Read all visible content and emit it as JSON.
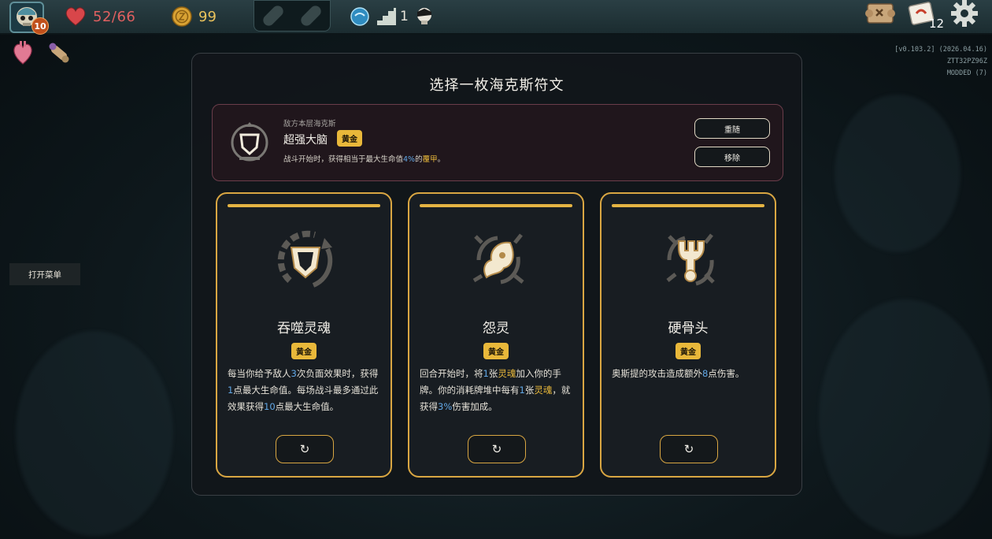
{
  "topbar": {
    "level": "10",
    "hp": "52/66",
    "gold": "99",
    "floor": "1",
    "deck_count": "12"
  },
  "icons": {
    "character": "skull-helmet-icon",
    "hp": "heart-icon",
    "gold": "coin-icon",
    "floor": "stairs-icon",
    "map": "map-scroll-icon",
    "deck": "card-deck-icon",
    "settings": "gear-icon",
    "reroll": "refresh-icon"
  },
  "version": {
    "line1": "[v0.103.2] (2026.04.16)",
    "line2": "ZTT32PZ96Z",
    "line3": "MODDED (7)"
  },
  "menu": {
    "open_label": "打开菜单"
  },
  "panel": {
    "title": "选择一枚海克斯符文",
    "enemy": {
      "subtitle": "敌方本层海克斯",
      "name": "超强大脑",
      "tier": "黄金",
      "desc_pre": "战斗开始时，获得相当于最大生命值",
      "desc_pct": "4%",
      "desc_mid": "的",
      "desc_kw": "覆甲",
      "desc_end": "。",
      "reroll_label": "重随",
      "remove_label": "移除"
    },
    "cards": [
      {
        "name": "吞噬灵魂",
        "tier": "黄金",
        "d1": "每当你给予敌人",
        "n1": "3",
        "d2": "次负面效果时，获得",
        "n2": "1",
        "d3": "点最大生命值。每场战斗最多通过此效果获得",
        "n3": "10",
        "d4": "点最大生命值。"
      },
      {
        "name": "怨灵",
        "tier": "黄金",
        "d1": "回合开始时，将",
        "n1": "1",
        "d2": "张",
        "k1": "灵魂",
        "d3": "加入你的手牌。你的消耗牌堆中每有",
        "n2": "1",
        "d4": "张",
        "k2": "灵魂",
        "d5": "，就获得",
        "n3": "3%",
        "d6": "伤害加成。"
      },
      {
        "name": "硬骨头",
        "tier": "黄金",
        "d1": "奥斯提的攻击造成额外",
        "n1": "8",
        "d2": "点伤害。"
      }
    ]
  },
  "colors": {
    "gold": "#e9b83a",
    "blue": "#62a8e6",
    "hp": "#e06060",
    "card_border": "#d9a642",
    "enemy_border": "#6a3d4a"
  }
}
